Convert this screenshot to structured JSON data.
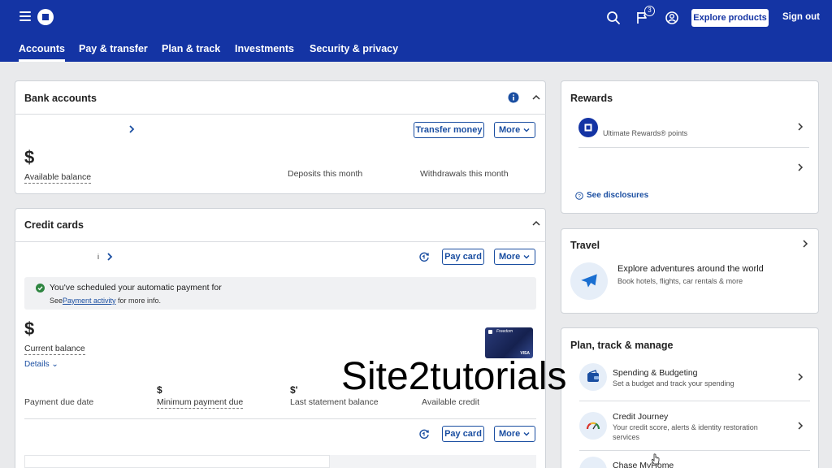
{
  "header": {
    "explore_label": "Explore products",
    "signout_label": "Sign out",
    "notification_count": "3",
    "nav": [
      "Accounts",
      "Pay & transfer",
      "Plan & track",
      "Investments",
      "Security & privacy"
    ]
  },
  "bank": {
    "title": "Bank accounts",
    "transfer_label": "Transfer money",
    "more_label": "More",
    "balance_symbol": "$",
    "available_balance_label": "Available balance",
    "deposits_label": "Deposits this month",
    "withdrawals_label": "Withdrawals this month"
  },
  "credit": {
    "title": "Credit cards",
    "account_char": "i",
    "pay_label": "Pay card",
    "more_label": "More",
    "notice_text": "You've scheduled your automatic payment for",
    "notice_see": "See",
    "notice_link": "Payment activity",
    "notice_rest": "for more info.",
    "balance_symbol": "$",
    "current_balance_label": "Current balance",
    "details_label": "Details",
    "card_brand": "Freedom",
    "card_network": "VISA",
    "min_symbol": "$",
    "stmt_symbol": "$'",
    "payment_due_label": "Payment due date",
    "min_payment_label": "Minimum payment due",
    "last_statement_label": "Last statement balance",
    "available_credit_label": "Available credit",
    "pay2_label": "Pay card",
    "more2_label": "More"
  },
  "rewards": {
    "title": "Rewards",
    "item_label": "Ultimate Rewards® points",
    "disclosures_label": "See disclosures"
  },
  "travel": {
    "title": "Travel",
    "headline": "Explore adventures around the world",
    "sub": "Book hotels, flights, car rentals & more"
  },
  "plan": {
    "title": "Plan, track & manage",
    "items": [
      {
        "title": "Spending & Budgeting",
        "sub": "Set a budget and track your spending"
      },
      {
        "title": "Credit Journey",
        "sub": "Your credit score, alerts & identity restoration",
        "sub2": "services"
      },
      {
        "title": "Chase MyHome"
      }
    ]
  },
  "watermark": "Site2tutorials",
  "colors": {
    "brand": "#1434a4",
    "link": "#1a4ea1",
    "success": "#2e8540"
  }
}
